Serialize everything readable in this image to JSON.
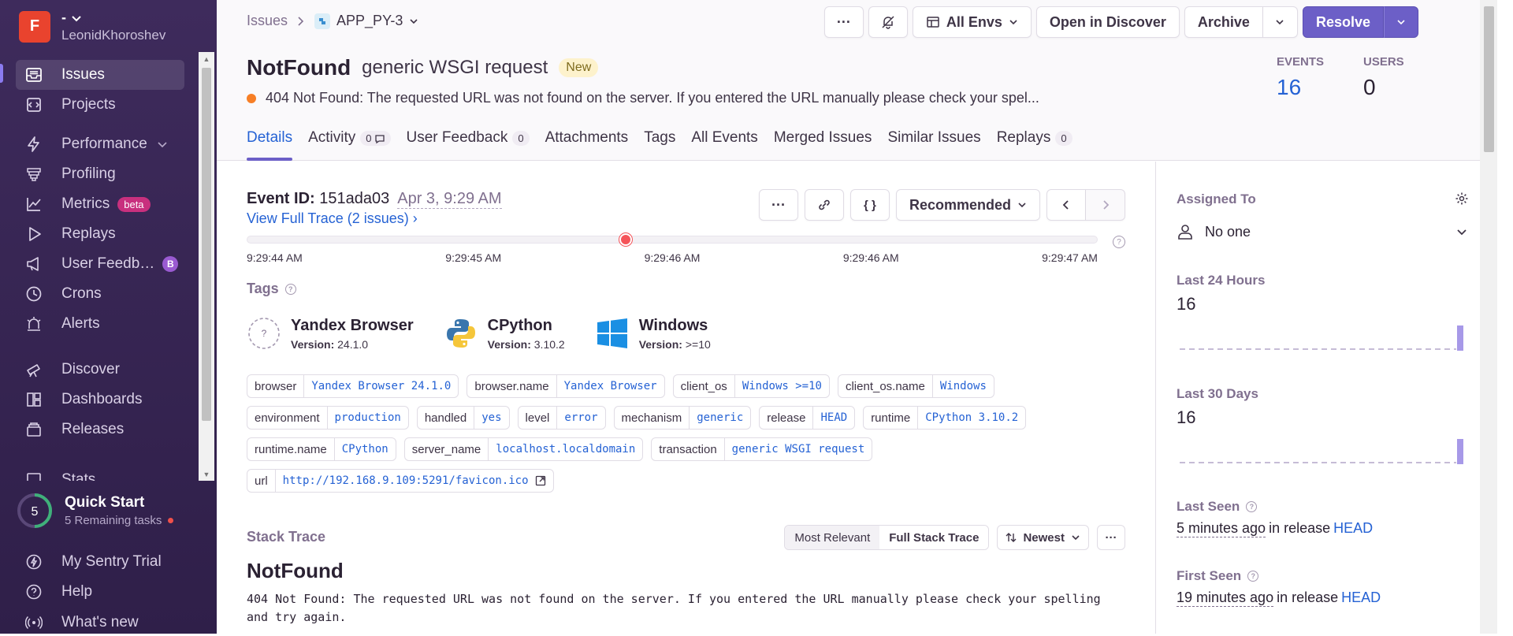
{
  "colors": {
    "accent": "#6c5fc7",
    "link": "#2562d4",
    "sidebar_bg": "#3e2b5c",
    "org_badge": "#e9432e",
    "error_marker": "#f55459"
  },
  "org": {
    "initial": "F",
    "name": "-",
    "user": "LeonidKhoroshev"
  },
  "nav": [
    {
      "label": "Issues",
      "icon": "issues-icon"
    },
    {
      "label": "Projects",
      "icon": "projects-icon"
    },
    {
      "label": "Performance",
      "icon": "lightning-icon"
    },
    {
      "label": "Profiling",
      "icon": "profiling-icon"
    },
    {
      "label": "Metrics",
      "icon": "metrics-icon",
      "badge": "beta"
    },
    {
      "label": "Replays",
      "icon": "play-icon"
    },
    {
      "label": "User Feedb…",
      "icon": "megaphone-icon",
      "badge": "B"
    },
    {
      "label": "Crons",
      "icon": "clock-icon"
    },
    {
      "label": "Alerts",
      "icon": "siren-icon"
    },
    {
      "label": "Discover",
      "icon": "telescope-icon"
    },
    {
      "label": "Dashboards",
      "icon": "dashboard-icon"
    },
    {
      "label": "Releases",
      "icon": "package-icon"
    },
    {
      "label": "Stats",
      "icon": "stats-icon"
    }
  ],
  "quickstart": {
    "count": "5",
    "title": "Quick Start",
    "subtitle": "5 Remaining tasks"
  },
  "bottom": [
    {
      "label": "My Sentry Trial",
      "icon": "lightning-circle-icon"
    },
    {
      "label": "Help",
      "icon": "help-icon"
    },
    {
      "label": "What's new",
      "icon": "broadcast-icon"
    }
  ],
  "breadcrumb": {
    "root": "Issues",
    "project": "APP_PY-3"
  },
  "toolbar": {
    "more": "···",
    "envs": "All Envs",
    "discover": "Open in Discover",
    "archive": "Archive",
    "resolve": "Resolve"
  },
  "issue": {
    "title": "NotFound",
    "subtitle": "generic WSGI request",
    "badge": "New",
    "message": "404 Not Found: The requested URL was not found on the server. If you entered the URL manually please check your spel..."
  },
  "stats": {
    "events_label": "EVENTS",
    "events": "16",
    "users_label": "USERS",
    "users": "0"
  },
  "tabs": [
    {
      "label": "Details"
    },
    {
      "label": "Activity",
      "count": "0"
    },
    {
      "label": "User Feedback",
      "count": "0"
    },
    {
      "label": "Attachments"
    },
    {
      "label": "Tags"
    },
    {
      "label": "All Events"
    },
    {
      "label": "Merged Issues"
    },
    {
      "label": "Similar Issues"
    },
    {
      "label": "Replays",
      "count": "0"
    }
  ],
  "event": {
    "id_label": "Event ID:",
    "id": "151ada03",
    "date": "Apr 3, 9:29 AM",
    "trace_link": "View Full Trace (2 issues)",
    "recommended": "Recommended",
    "braces": "{ }"
  },
  "timeline": {
    "marker_fraction": 0.445,
    "labels": [
      "9:29:44 AM",
      "9:29:45 AM",
      "9:29:46 AM",
      "9:29:46 AM",
      "9:29:47 AM"
    ]
  },
  "tags_title": "Tags",
  "contexts": [
    {
      "name": "Yandex Browser",
      "version_label": "Version:",
      "version": "24.1.0",
      "icon": "unknown-browser-icon"
    },
    {
      "name": "CPython",
      "version_label": "Version:",
      "version": "3.10.2",
      "icon": "python-icon"
    },
    {
      "name": "Windows",
      "version_label": "Version:",
      "version": ">=10",
      "icon": "windows-icon"
    }
  ],
  "tags": [
    {
      "key": "browser",
      "value": "Yandex Browser 24.1.0"
    },
    {
      "key": "browser.name",
      "value": "Yandex Browser"
    },
    {
      "key": "client_os",
      "value": "Windows >=10"
    },
    {
      "key": "client_os.name",
      "value": "Windows"
    },
    {
      "key": "environment",
      "value": "production"
    },
    {
      "key": "handled",
      "value": "yes"
    },
    {
      "key": "level",
      "value": "error"
    },
    {
      "key": "mechanism",
      "value": "generic"
    },
    {
      "key": "release",
      "value": "HEAD"
    },
    {
      "key": "runtime",
      "value": "CPython 3.10.2"
    },
    {
      "key": "runtime.name",
      "value": "CPython"
    },
    {
      "key": "server_name",
      "value": "localhost.localdomain"
    },
    {
      "key": "transaction",
      "value": "generic WSGI request"
    },
    {
      "key": "url",
      "value": "http://192.168.9.109:5291/favicon.ico",
      "external": true
    }
  ],
  "stack": {
    "title": "Stack Trace",
    "most_relevant": "Most Relevant",
    "full": "Full Stack Trace",
    "sort": "Newest",
    "exception": "NotFound",
    "message": "404 Not Found: The requested URL was not found on the server. If you entered the URL manually please check your spelling and try again."
  },
  "sidebar_right": {
    "assigned_title": "Assigned To",
    "assigned_value": "No one",
    "last24_title": "Last 24 Hours",
    "last24_value": "16",
    "last24_series": [
      0,
      0,
      0,
      0,
      0,
      0,
      0,
      0,
      0,
      0,
      0,
      0,
      0,
      0,
      0,
      0,
      0,
      0,
      0,
      0,
      0,
      0,
      0,
      16
    ],
    "last30_title": "Last 30 Days",
    "last30_value": "16",
    "last30_series": [
      0,
      0,
      0,
      0,
      0,
      0,
      0,
      0,
      0,
      0,
      0,
      0,
      0,
      0,
      0,
      0,
      0,
      0,
      0,
      0,
      0,
      0,
      0,
      0,
      0,
      0,
      0,
      0,
      0,
      16
    ],
    "last_seen_title": "Last Seen",
    "last_seen": "5 minutes ago",
    "last_seen_mid": "in release",
    "last_seen_release": "HEAD",
    "first_seen_title": "First Seen",
    "first_seen": "19 minutes ago",
    "first_seen_mid": "in release",
    "first_seen_release": "HEAD"
  }
}
